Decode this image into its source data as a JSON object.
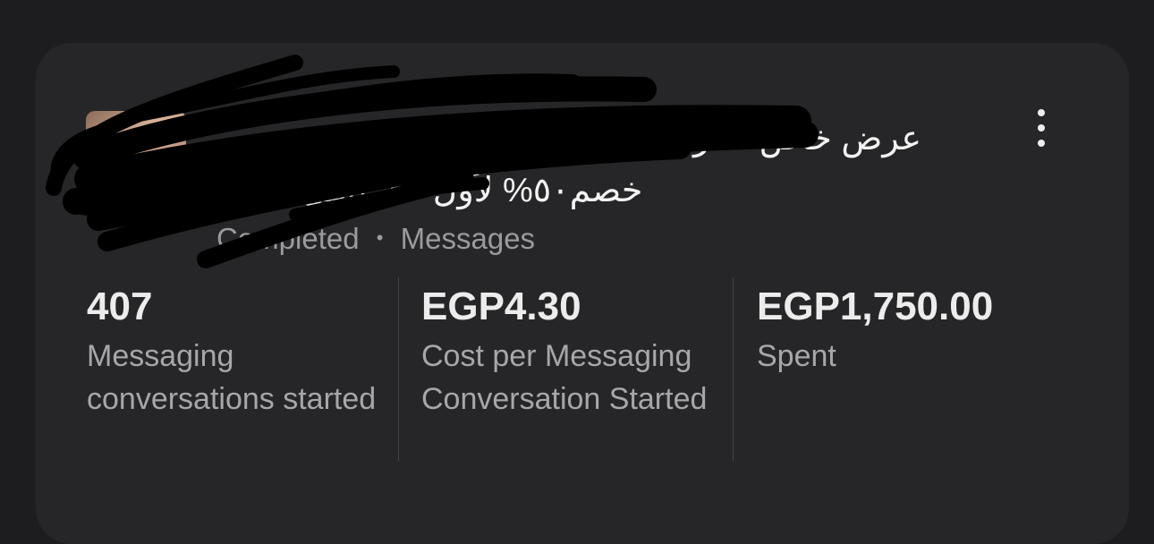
{
  "ad": {
    "title_line1": "عرض خاص لفترة محدودة",
    "title_line2_text": "خصم٥٠% لأول ٢٠ عميل",
    "title_line2_emoji": "💥",
    "title_line2_quote": "\"",
    "status": "Completed",
    "separator": "•",
    "objective": "Messages",
    "thumbnail_icon": "ad-thumbnail-image",
    "more_icon": "more-vertical-icon"
  },
  "metrics": [
    {
      "value": "407",
      "label": "Messaging conversations started"
    },
    {
      "value": "EGP4.30",
      "label": "Cost per Messaging Conversation Started"
    },
    {
      "value": "EGP1,750.00",
      "label": "Spent"
    }
  ],
  "colors": {
    "background": "#1d1d1f",
    "card": "#262628",
    "text_primary": "#ececec",
    "text_secondary": "#9b9b9e",
    "redaction": "#000000"
  }
}
